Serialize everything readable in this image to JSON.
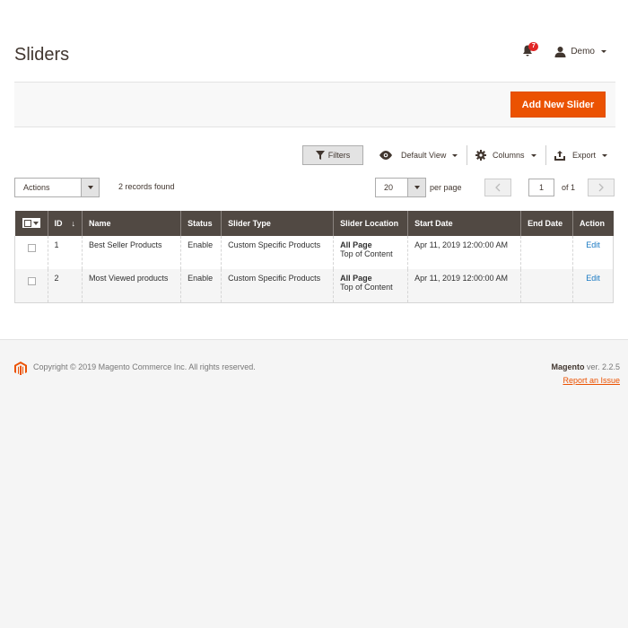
{
  "page": {
    "title": "Sliders"
  },
  "header": {
    "notifications_count": "7",
    "user_name": "Demo"
  },
  "action_bar": {
    "add_button": "Add New Slider"
  },
  "toolbar": {
    "filters": "Filters",
    "view": "Default View",
    "columns": "Columns",
    "export": "Export"
  },
  "grid_controls": {
    "actions_label": "Actions",
    "records_found": "2 records found",
    "per_page_value": "20",
    "per_page_label": "per page",
    "current_page": "1",
    "total_pages_label": "of 1"
  },
  "grid": {
    "columns": [
      "ID",
      "Name",
      "Status",
      "Slider Type",
      "Slider Location",
      "Start Date",
      "End Date",
      "Action"
    ],
    "rows": [
      {
        "id": "1",
        "name": "Best Seller Products",
        "status": "Enable",
        "type": "Custom Specific Products",
        "location": "All Page",
        "location_sub": "Top of Content",
        "start": "Apr 11, 2019 12:00:00 AM",
        "end": "",
        "action": "Edit"
      },
      {
        "id": "2",
        "name": "Most Viewed products",
        "status": "Enable",
        "type": "Custom Specific Products",
        "location": "All Page",
        "location_sub": "Top of Content",
        "start": "Apr 11, 2019 12:00:00 AM",
        "end": "",
        "action": "Edit"
      }
    ]
  },
  "footer": {
    "copyright": "Copyright © 2019 Magento Commerce Inc. All rights reserved.",
    "brand": "Magento",
    "version": " ver. 2.2.5",
    "report_link": "Report an Issue"
  },
  "colors": {
    "accent": "#eb5202",
    "header_bg": "#514943",
    "link": "#1979c3"
  }
}
